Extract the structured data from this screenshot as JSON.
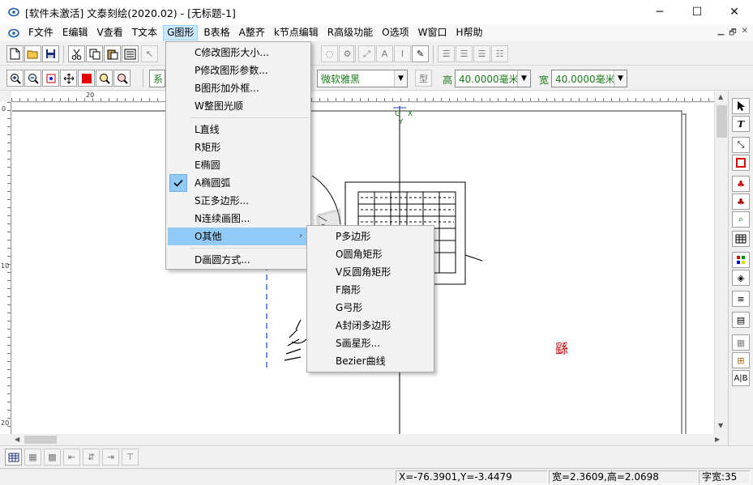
{
  "window": {
    "title": "[软件未激活] 文泰刻绘(2020.02) - [无标题-1]",
    "minimize": "─",
    "maximize": "☐",
    "close": "✕"
  },
  "menubar": {
    "items": [
      {
        "label": "F文件",
        "name": "menu-file"
      },
      {
        "label": "E编辑",
        "name": "menu-edit"
      },
      {
        "label": "V查看",
        "name": "menu-view"
      },
      {
        "label": "T文本",
        "name": "menu-text"
      },
      {
        "label": "G图形",
        "name": "menu-graphics"
      },
      {
        "label": "B表格",
        "name": "menu-table"
      },
      {
        "label": "A整齐",
        "name": "menu-align"
      },
      {
        "label": "k节点编辑",
        "name": "menu-node-edit"
      },
      {
        "label": "R高级功能",
        "name": "menu-advanced"
      },
      {
        "label": "O选项",
        "name": "menu-options"
      },
      {
        "label": "W窗口",
        "name": "menu-window"
      },
      {
        "label": "H帮助",
        "name": "menu-help"
      }
    ],
    "mdi_min": "▁",
    "mdi_restore": "🗗",
    "mdi_close": "✕"
  },
  "toolbar2": {
    "font_name": "微软雅黑",
    "style_label": "型",
    "height_label": "高",
    "height_value": "40.0000毫米",
    "width_label": "宽",
    "width_value": "40.0000毫米",
    "partial_label": "系"
  },
  "graphics_menu": {
    "items": [
      {
        "label": "C修改图形大小...",
        "name": "menu-resize-shape"
      },
      {
        "label": "P修改图形参数...",
        "name": "menu-shape-params"
      },
      {
        "label": "B图形加外框...",
        "name": "menu-add-frame"
      },
      {
        "label": "W整图光顺",
        "name": "menu-smooth"
      },
      {
        "label": "L直线",
        "name": "menu-line"
      },
      {
        "label": "R矩形",
        "name": "menu-rectangle"
      },
      {
        "label": "E椭圆",
        "name": "menu-ellipse"
      },
      {
        "label": "A椭圆弧",
        "name": "menu-elliptic-arc"
      },
      {
        "label": "S正多边形...",
        "name": "menu-regular-polygon"
      },
      {
        "label": "N连续画图...",
        "name": "menu-continuous-draw"
      },
      {
        "label": "O其他",
        "name": "menu-other"
      },
      {
        "label": "D画圆方式...",
        "name": "menu-circle-mode"
      }
    ]
  },
  "other_submenu": {
    "items": [
      {
        "label": "P多边形",
        "name": "submenu-polygon"
      },
      {
        "label": "O圆角矩形",
        "name": "submenu-rounded-rect"
      },
      {
        "label": "V反圆角矩形",
        "name": "submenu-inverse-rounded-rect"
      },
      {
        "label": "F扇形",
        "name": "submenu-sector"
      },
      {
        "label": "G弓形",
        "name": "submenu-segment"
      },
      {
        "label": "A封闭多边形",
        "name": "submenu-closed-polygon"
      },
      {
        "label": "S画星形...",
        "name": "submenu-star"
      },
      {
        "label": "Bezier曲线",
        "name": "submenu-bezier"
      }
    ]
  },
  "rulers": {
    "h_20": "20",
    "v_0": "0",
    "v_10": "10",
    "v_20": "20"
  },
  "canvas": {
    "axis_g": "G",
    "axis_x": "X",
    "axis_y": "Y",
    "red_glyph": "繇"
  },
  "statusbar": {
    "coords": "X=-76.3901,Y=-3.4479",
    "size": "宽=2.3609,高=2.0698",
    "char_width": "字宽:35"
  },
  "colors": {
    "menu_highlight": "#91c9f7",
    "active_menu": "#cce8ff",
    "label_green": "#1a7a1a",
    "guide_blue": "#2040c0"
  }
}
